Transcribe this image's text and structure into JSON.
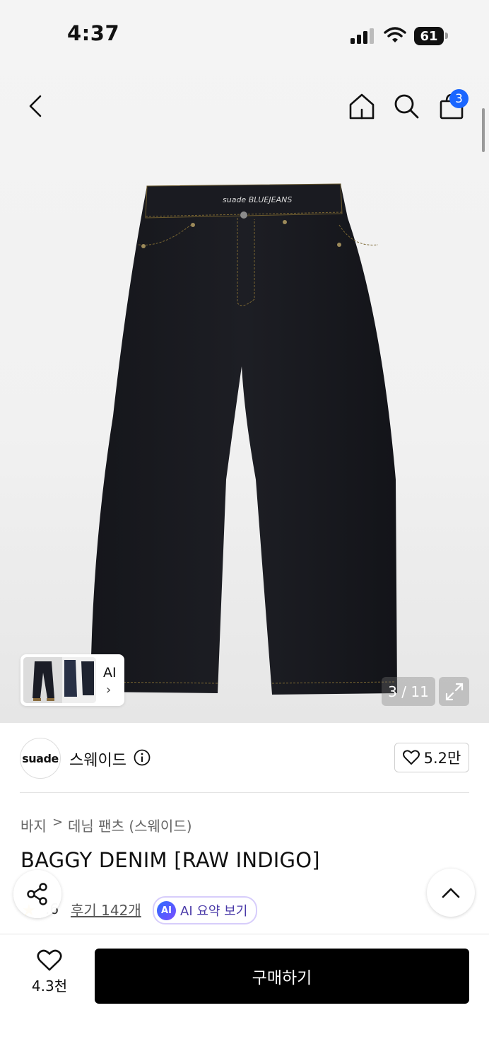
{
  "status_bar": {
    "time": "4:37",
    "battery": "61"
  },
  "top_nav": {
    "cart_count": "3"
  },
  "gallery": {
    "counter": "3 / 11",
    "thumb_ai_label": "AI",
    "thumb_chevron": "›",
    "waistband_text": "suade BLUEJEANS"
  },
  "brand": {
    "logo_text": "suade",
    "name": "스웨이드",
    "likes": "5.2만"
  },
  "breadcrumb": {
    "level1": "바지",
    "separator": ">",
    "level2": "데님 팬츠 (스웨이드)"
  },
  "product": {
    "title": "BAGGY DENIM [RAW INDIGO]"
  },
  "rating": {
    "star": "★",
    "value": ".6",
    "reviews": "후기 142개"
  },
  "ai_summary": {
    "badge": "AI",
    "label": "AI 요약 보기"
  },
  "bottom_bar": {
    "wish_count": "4.3천",
    "buy_label": "구매하기"
  },
  "colors": {
    "accent_blue": "#1a66ff",
    "buy_button": "#000000",
    "star": "#f6b500"
  }
}
